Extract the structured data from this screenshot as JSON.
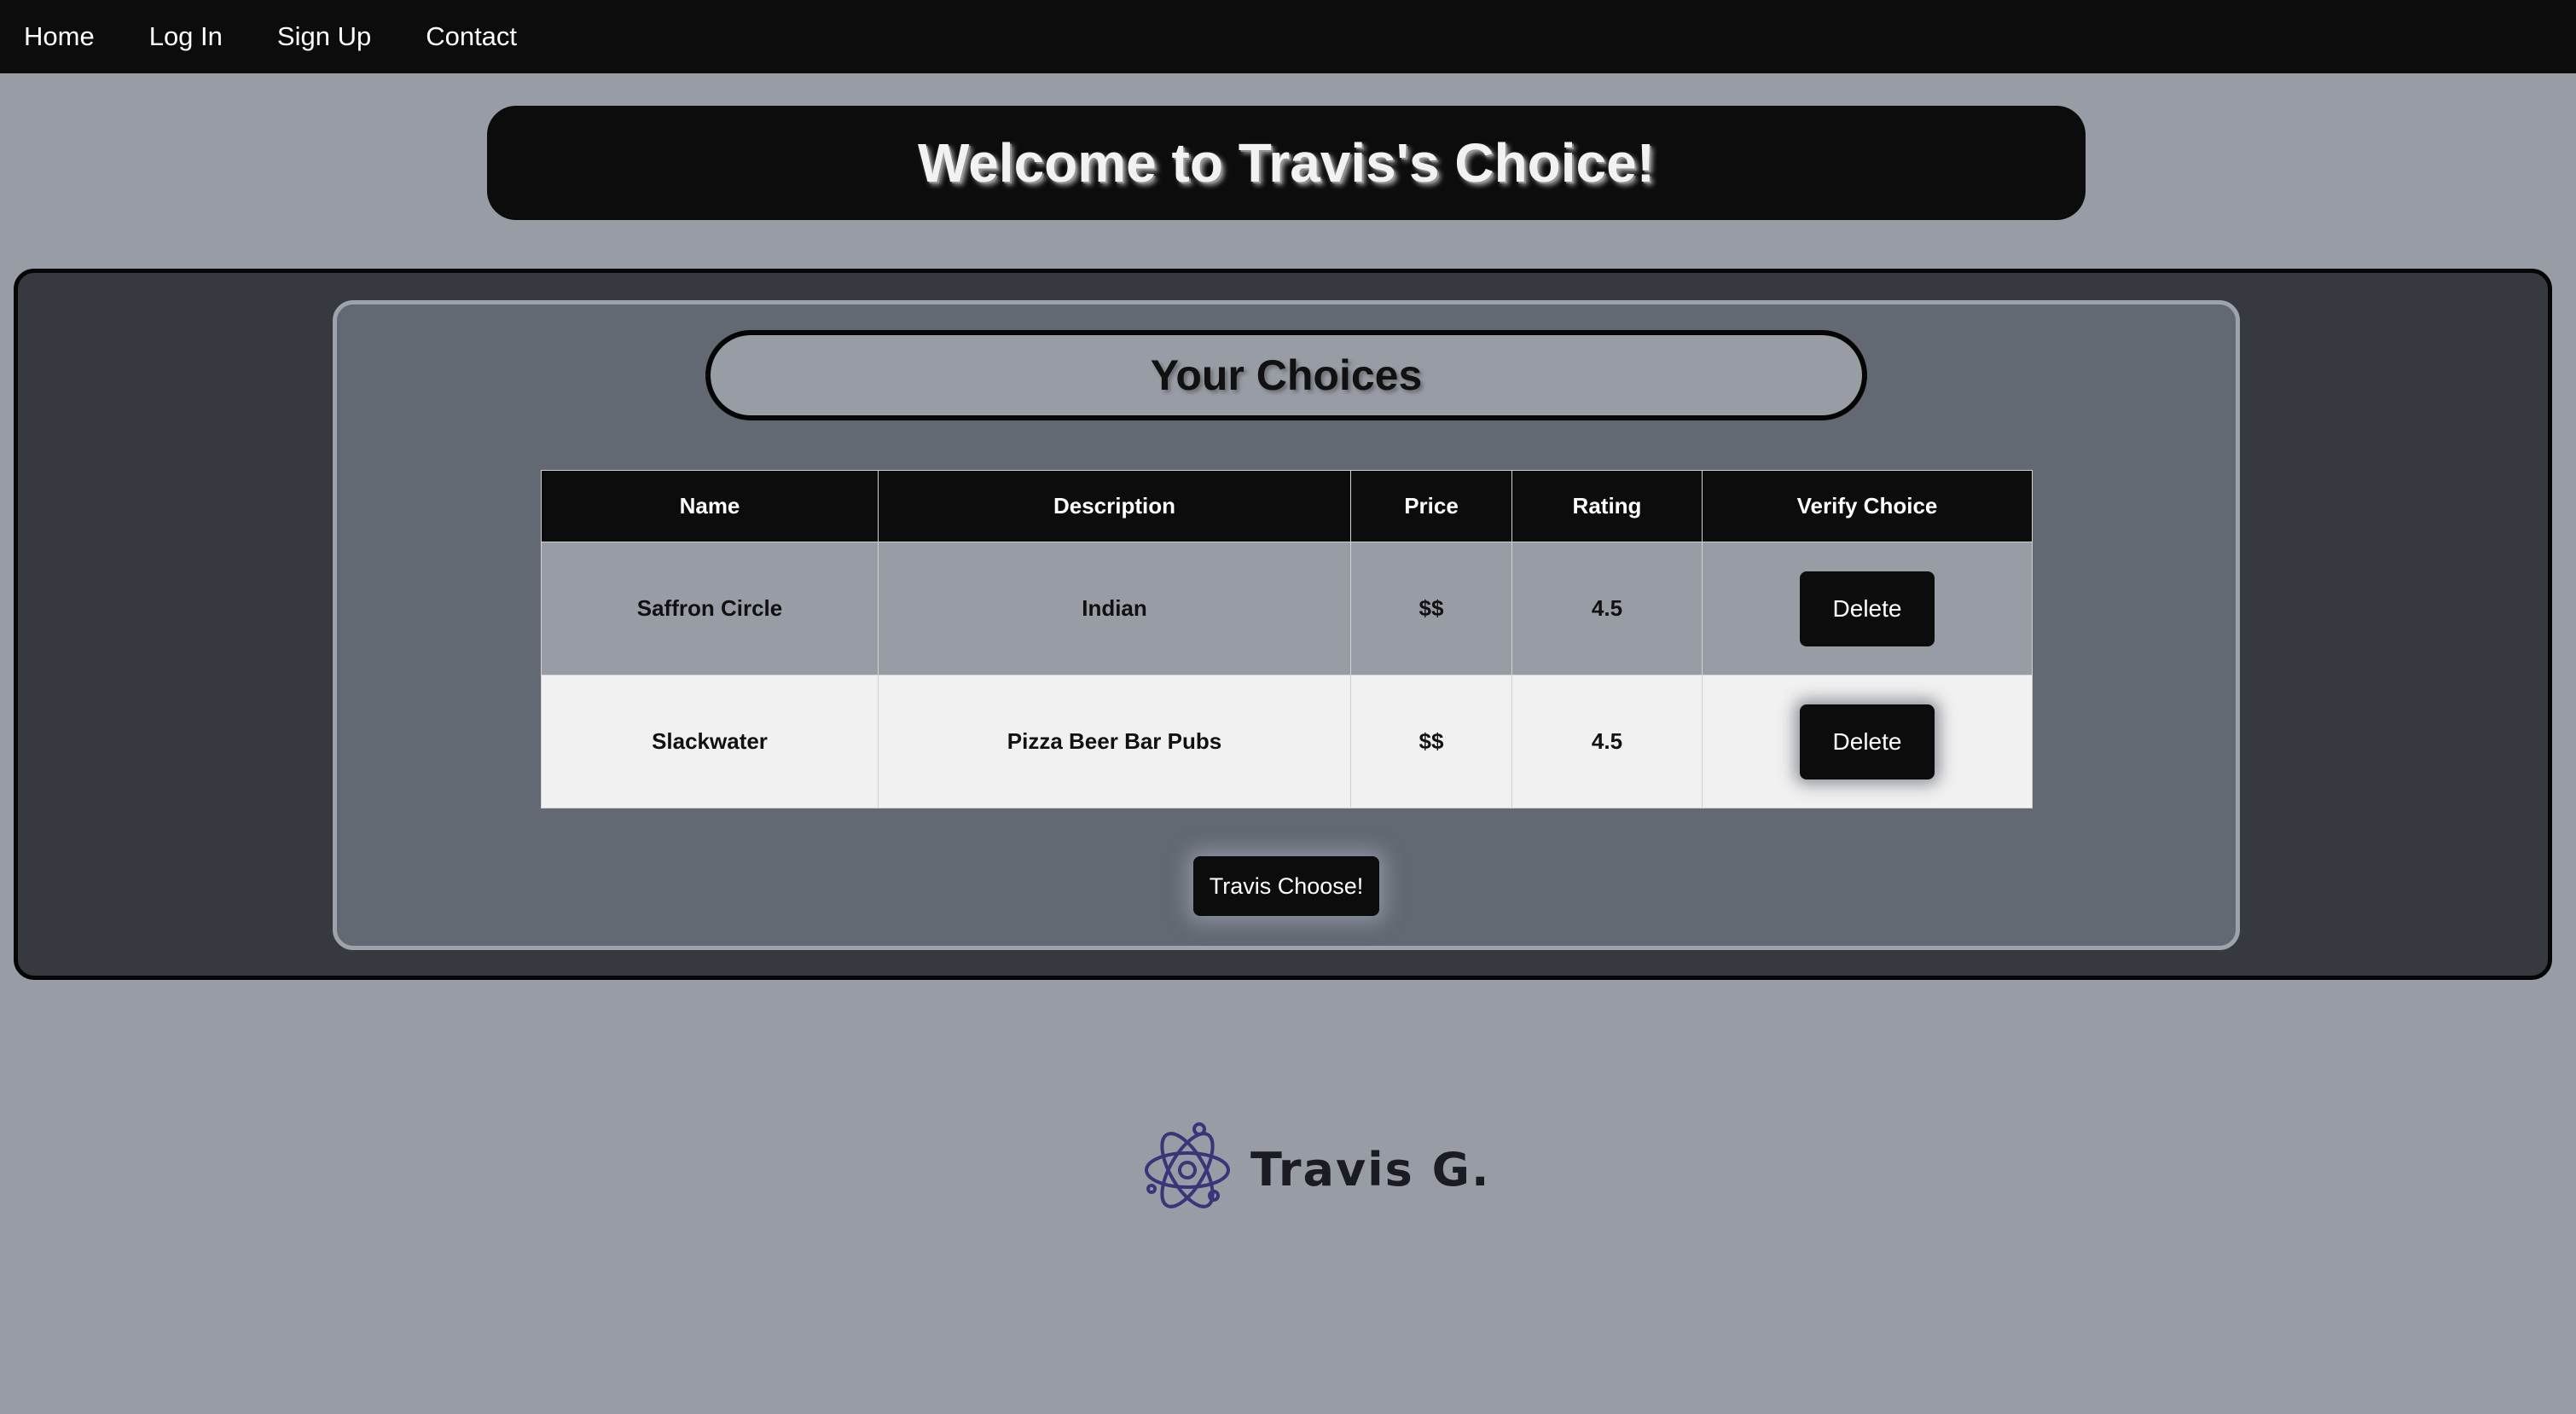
{
  "nav": {
    "links": [
      "Home",
      "Log In",
      "Sign Up",
      "Contact"
    ]
  },
  "header": {
    "title": "Welcome to Travis's Choice!"
  },
  "choices": {
    "title": "Your Choices",
    "columns": [
      "Name",
      "Description",
      "Price",
      "Rating",
      "Verify Choice"
    ],
    "rows": [
      {
        "name": "Saffron Circle",
        "description": "Indian",
        "price": "$$",
        "rating": "4.5",
        "action": "Delete"
      },
      {
        "name": "Slackwater",
        "description": "Pizza Beer Bar Pubs",
        "price": "$$",
        "rating": "4.5",
        "action": "Delete"
      }
    ],
    "choose_label": "Travis Choose!"
  },
  "footer": {
    "logo_text": "Travis G.",
    "logo_icon": "atom-icon"
  },
  "colors": {
    "page_bg": "#989ca5",
    "nav_bg": "#0c0c0d",
    "outer_panel": "#36393f",
    "inner_panel": "#636972",
    "logo_accent": "#3a3478"
  }
}
